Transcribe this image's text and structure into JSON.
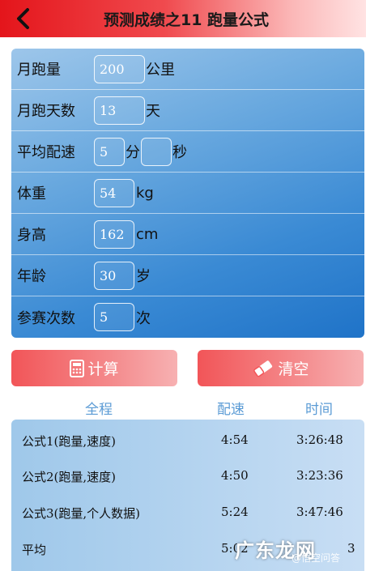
{
  "header": {
    "title": "预测成绩之11 跑量公式"
  },
  "form": {
    "monthly_distance": {
      "label": "月跑量",
      "value": "200",
      "unit": "公里"
    },
    "monthly_days": {
      "label": "月跑天数",
      "value": "13",
      "unit": "天"
    },
    "avg_pace": {
      "label": "平均配速",
      "minutes": "5",
      "minutes_unit": "分",
      "seconds": "",
      "seconds_unit": "秒"
    },
    "weight": {
      "label": "体重",
      "value": "54",
      "unit": "kg"
    },
    "height": {
      "label": "身高",
      "value": "162",
      "unit": "cm"
    },
    "age": {
      "label": "年龄",
      "value": "30",
      "unit": "岁"
    },
    "race_count": {
      "label": "参赛次数",
      "value": "5",
      "unit": "次"
    }
  },
  "buttons": {
    "calculate_label": "计算",
    "clear_label": "清空"
  },
  "results": {
    "headers": {
      "distance": "全程",
      "pace": "配速",
      "time": "时间"
    },
    "rows": [
      {
        "name": "公式1(跑量,速度)",
        "pace": "4:54",
        "time": "3:26:48"
      },
      {
        "name": "公式2(跑量,速度)",
        "pace": "4:50",
        "time": "3:23:36"
      },
      {
        "name": "公式3(跑量,个人数据)",
        "pace": "5:24",
        "time": "3:47:46"
      },
      {
        "name": "平均",
        "pace": "5:02",
        "time": "3"
      }
    ]
  },
  "watermark": {
    "text": "广东龙网",
    "sub": "@悟空问答"
  },
  "colors": {
    "header_red": "#e4151b",
    "panel_blue": "#3a8ad4",
    "button_red": "#f25558",
    "column_header_blue": "#5b9bd5"
  }
}
